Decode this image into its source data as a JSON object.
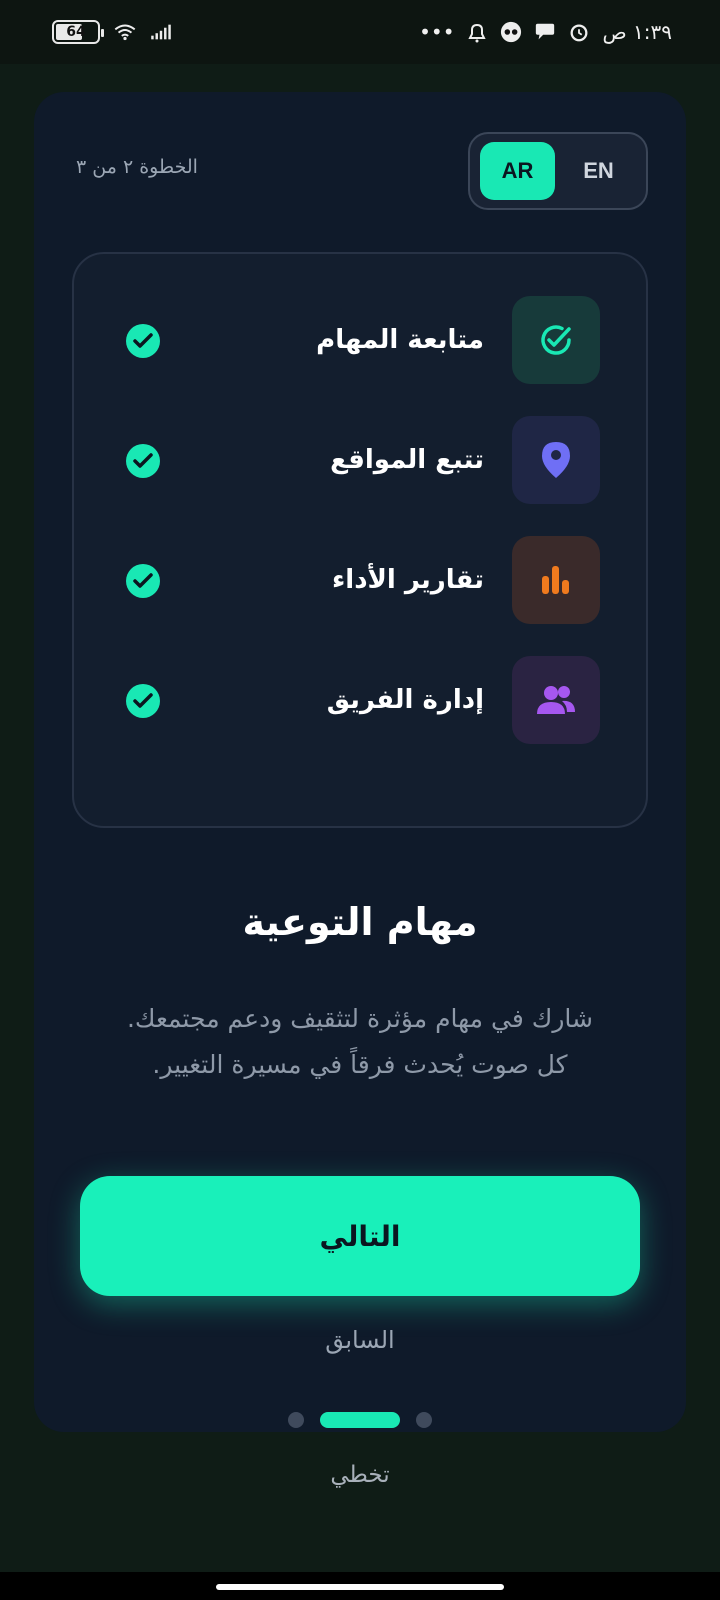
{
  "status_bar": {
    "time": "١:٣٩ ص",
    "battery_level": "64",
    "signal_icon": "signal-bars-icon",
    "wifi_icon": "wifi-icon",
    "notification_icons": [
      "alarm-icon",
      "chat-bubble-icon",
      "tag-icon",
      "bell-icon",
      "more-dots-icon"
    ]
  },
  "header": {
    "step_text": "الخطوة ٢ من ٣",
    "lang_ar": "AR",
    "lang_en": "EN",
    "active_lang": "AR"
  },
  "features": [
    {
      "label": "متابعة المهام",
      "icon": "check-circle-icon",
      "icon_color": "#19e8b4",
      "icon_bg": "#173a3a"
    },
    {
      "label": "تتبع المواقع",
      "icon": "location-pin-icon",
      "icon_color": "#6f6ff5",
      "icon_bg": "#1f2645"
    },
    {
      "label": "تقارير الأداء",
      "icon": "bar-chart-icon",
      "icon_color": "#f07a1e",
      "icon_bg": "#3a2a2a"
    },
    {
      "label": "إدارة الفريق",
      "icon": "users-icon",
      "icon_color": "#a657f0",
      "icon_bg": "#2a2342"
    }
  ],
  "main": {
    "title": "مهام التوعية",
    "description_line1": "شارك في مهام مؤثرة لتثقيف ودعم مجتمعك.",
    "description_line2": "كل صوت يُحدث فرقاً في مسيرة التغيير."
  },
  "actions": {
    "next_label": "التالي",
    "previous_label": "السابق",
    "skip_label": "تخطي"
  },
  "pagination": {
    "total": 3,
    "current": 2
  },
  "colors": {
    "accent": "#19e8b4",
    "card_bg": "#0f1a2a"
  }
}
